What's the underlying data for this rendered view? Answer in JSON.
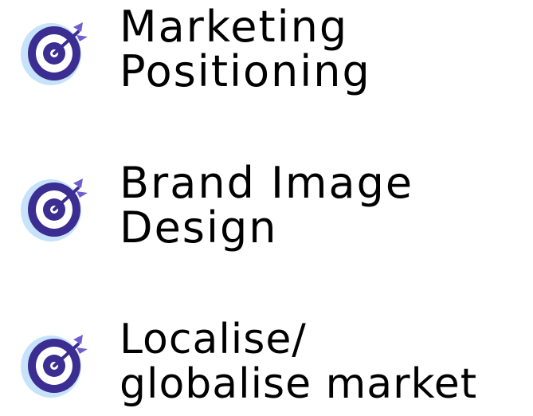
{
  "items": [
    {
      "line1": "Marketing",
      "line2": "Positioning",
      "icon": "target-dart-icon"
    },
    {
      "line1": "Brand Image",
      "line2": "Design",
      "icon": "target-dart-icon"
    },
    {
      "line1": "Localise/",
      "line2": "globalise market",
      "icon": "target-dart-icon"
    }
  ],
  "colors": {
    "text": "#000000",
    "target_outer": "#c7e3fb",
    "target_ring": "#3b2d91",
    "target_mid": "#ffffff",
    "dart": "#6f5ecf"
  }
}
